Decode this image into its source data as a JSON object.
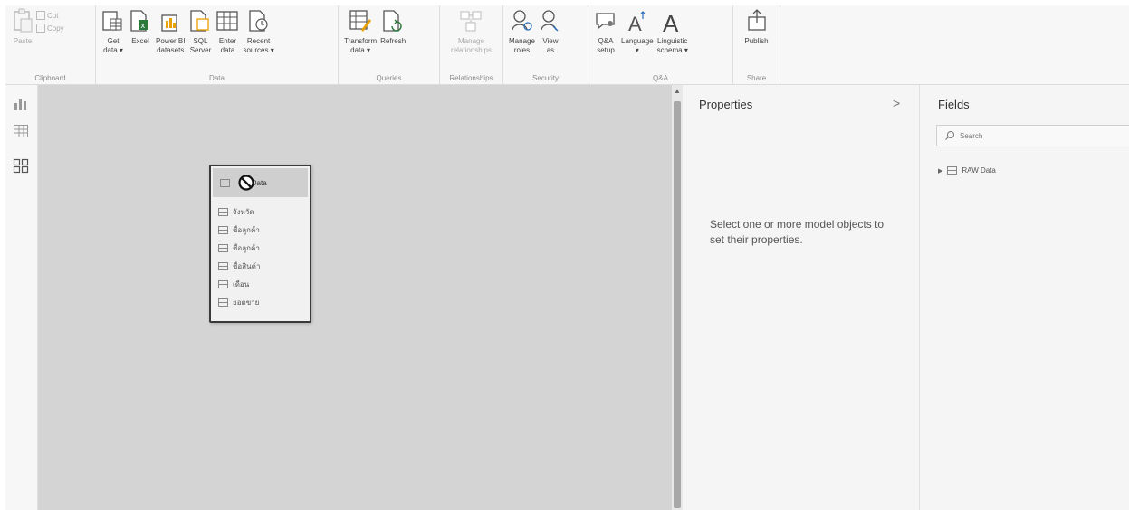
{
  "ribbon": {
    "clipboard": {
      "label": "Clipboard",
      "paste": "Paste",
      "cut": "Cut",
      "copy": "Copy"
    },
    "data": {
      "label": "Data",
      "buttons": [
        "Get\ndata ▾",
        "Excel",
        "Power BI\ndatasets",
        "SQL\nServer",
        "Enter\ndata",
        "Recent\nsources ▾"
      ]
    },
    "queries": {
      "label": "Queries",
      "buttons": [
        "Transform\ndata ▾",
        "Refresh"
      ]
    },
    "relationships": {
      "label": "Relationships",
      "buttons": [
        "Manage\nrelationships"
      ]
    },
    "security": {
      "label": "Security",
      "buttons": [
        "Manage\nroles",
        "View\nas"
      ]
    },
    "qa": {
      "label": "Q&A",
      "buttons": [
        "Q&A\nsetup",
        "Language\n▾",
        "Linguistic\nschema ▾"
      ]
    },
    "share": {
      "label": "Share",
      "buttons": [
        "Publish"
      ]
    }
  },
  "leftnav": {
    "icons": [
      "report-view-icon",
      "data-view-icon",
      "model-view-icon"
    ]
  },
  "table_card": {
    "title": "W Data",
    "fields": [
      "จังหวัด",
      "ชื่อลูกค้า",
      "ชื่อลูกค้า",
      "ชื่อสินค้า",
      "เดือน",
      "ยอดขาย"
    ]
  },
  "properties": {
    "title": "Properties",
    "chevron": ">",
    "message": "Select one or more model objects to set their properties."
  },
  "fields": {
    "title": "Fields",
    "search_placeholder": "Search",
    "tables": [
      "RAW Data"
    ]
  },
  "colors": {
    "canvas": "#d4d4d4",
    "pane": "#f5f5f5",
    "ribbon": "#f7f7f7",
    "accent": "#2b7a3b"
  }
}
